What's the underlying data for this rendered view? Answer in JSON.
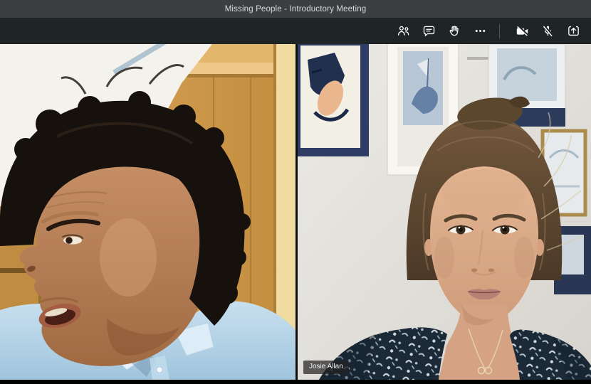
{
  "window": {
    "title": "Missing People - Introductory Meeting"
  },
  "toolbar": {
    "buttons": [
      {
        "name": "participants",
        "icon": "people-icon"
      },
      {
        "name": "chat",
        "icon": "chat-bubble-icon"
      },
      {
        "name": "raise-hand",
        "icon": "hand-icon"
      },
      {
        "name": "more-options",
        "icon": "ellipsis-icon"
      },
      {
        "name": "camera-toggle",
        "icon": "camera-off-icon",
        "state": "off"
      },
      {
        "name": "mic-toggle",
        "icon": "mic-muted-icon",
        "state": "muted"
      },
      {
        "name": "share",
        "icon": "share-tray-icon"
      }
    ]
  },
  "participants": {
    "left_tile": {
      "scene": "man with dark curly hair, light blue shirt, wooden cabinets behind"
    },
    "right_tile": {
      "name_label": "Josie Allan",
      "scene": "woman with brown hair tied back, dark floral top, framed pictures on white wall"
    }
  },
  "colors": {
    "titlebar": "#3b3f41",
    "toolbar": "#1f2427",
    "icon": "#ffffff",
    "stage_background": "#0b0d0e",
    "name_badge_background": "rgba(35,35,35,0.72)",
    "name_badge_text": "#f2f2f2"
  }
}
